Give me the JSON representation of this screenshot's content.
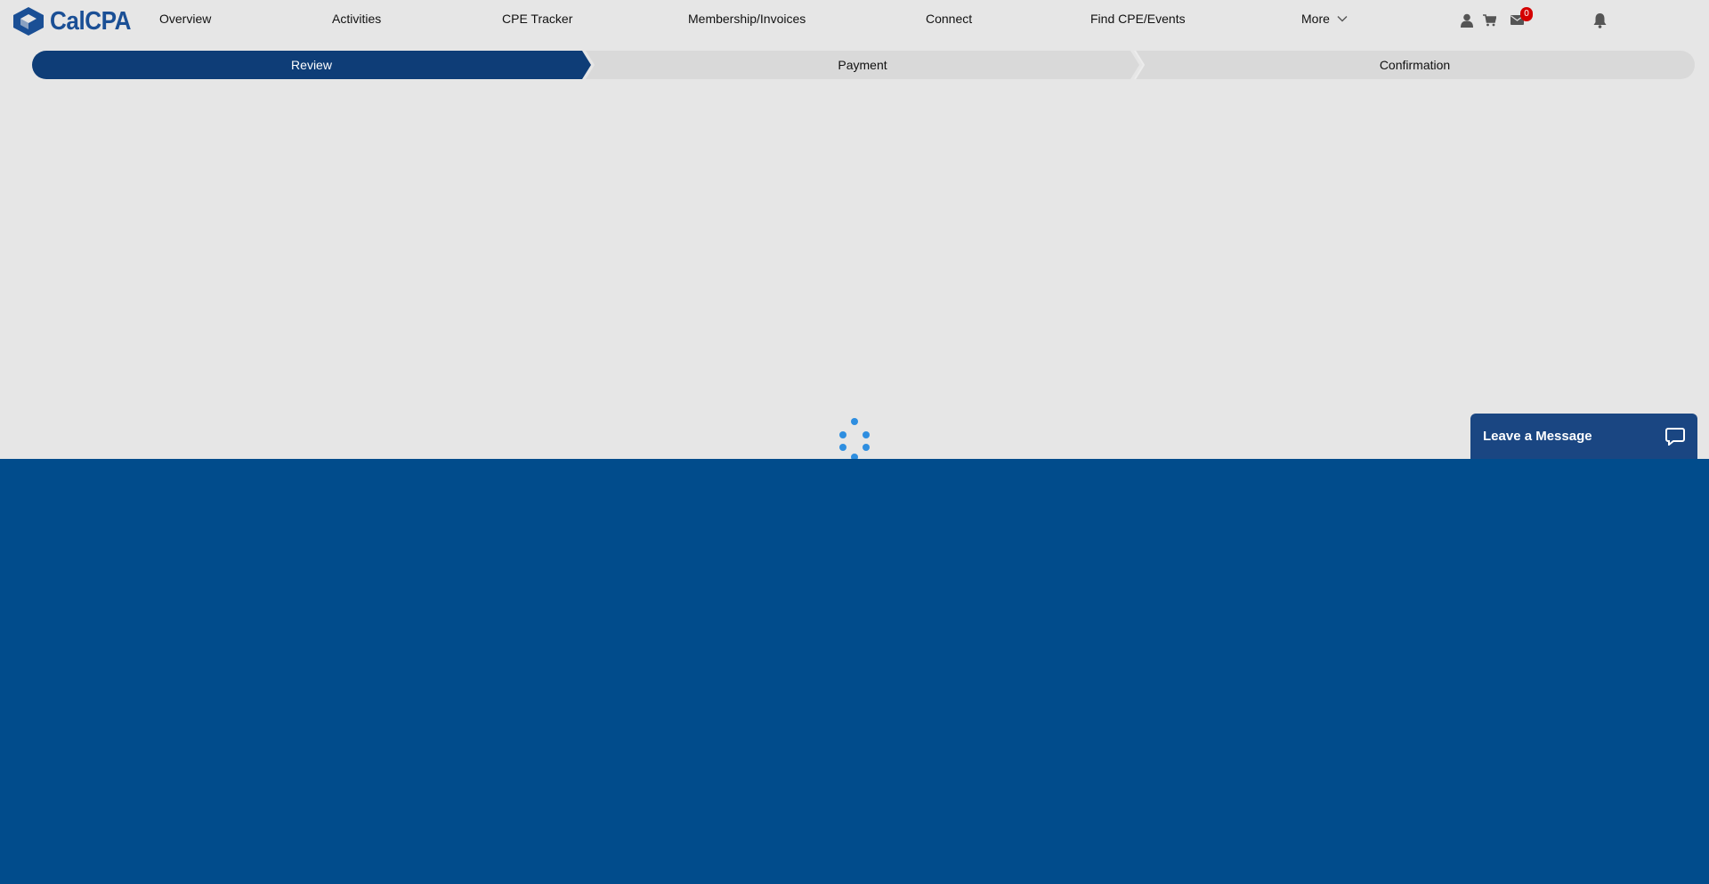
{
  "brand": {
    "logo_text": "CalCPA",
    "color": "#1a4f95"
  },
  "nav": {
    "items": [
      {
        "label": "Overview"
      },
      {
        "label": "Activities"
      },
      {
        "label": "CPE Tracker"
      },
      {
        "label": "Membership/Invoices"
      },
      {
        "label": "Connect"
      },
      {
        "label": "Find CPE/Events"
      }
    ],
    "more_label": "More",
    "icons": [
      "user-icon",
      "cart-icon",
      "mail-icon",
      "bell-icon"
    ],
    "mail_badge": "0",
    "badge_color": "#d40000"
  },
  "stepper": {
    "steps": [
      {
        "label": "Review",
        "active": true
      },
      {
        "label": "Payment",
        "active": false
      },
      {
        "label": "Confirmation",
        "active": false
      }
    ],
    "active_color": "#0e3d77",
    "inactive_color": "#d9d9d9"
  },
  "loader": {
    "icon": "loading-spinner",
    "color": "#2e8ee0"
  },
  "footer": {
    "color": "#014c8c"
  },
  "chat": {
    "label": "Leave a Message",
    "icon": "chat-bubble-icon",
    "color": "#1a4682"
  }
}
